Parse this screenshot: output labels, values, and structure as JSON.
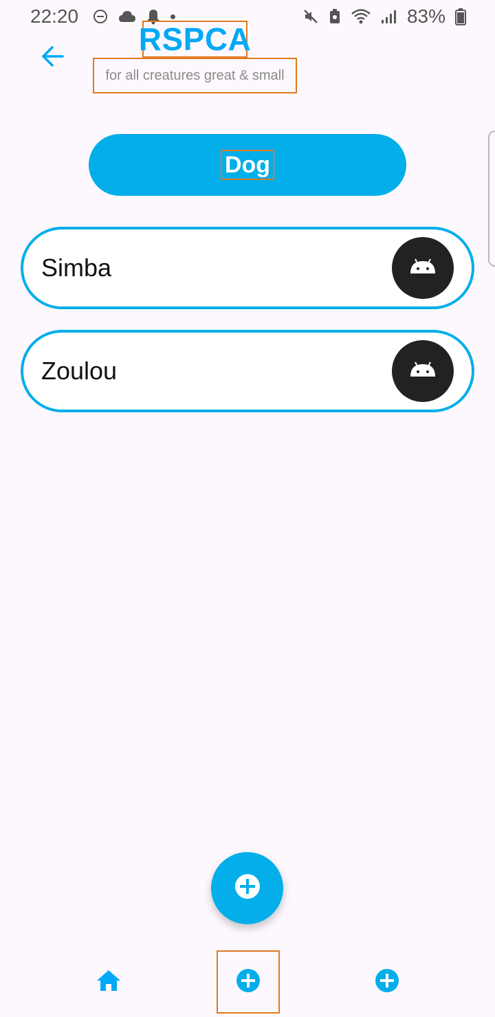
{
  "status_bar": {
    "time": "22:20",
    "battery": "83%",
    "left_icons": [
      "do-not-disturb-icon",
      "cloud-icon",
      "notification-bell-icon",
      "dot-icon"
    ],
    "right_icons": [
      "mute-icon",
      "battery-saver-icon",
      "wifi-icon",
      "signal-icon",
      "battery-icon"
    ]
  },
  "header": {
    "back_icon": "arrow-left-icon",
    "title": "RSPCA",
    "subtitle": "for all creatures great & small"
  },
  "category": {
    "label": "Dog"
  },
  "pets": [
    {
      "name": "Simba",
      "avatar_icon": "android-icon"
    },
    {
      "name": "Zoulou",
      "avatar_icon": "android-icon"
    }
  ],
  "fab": {
    "icon": "add-circle-icon"
  },
  "bottom_nav": {
    "items": [
      {
        "icon": "home-icon"
      },
      {
        "icon": "add-circle-icon"
      },
      {
        "icon": "add-circle-icon"
      }
    ]
  },
  "colors": {
    "accent": "#03aeea",
    "background": "#fdf8fd",
    "avatar_bg": "#222222",
    "highlight_box": "#e07a1f"
  }
}
